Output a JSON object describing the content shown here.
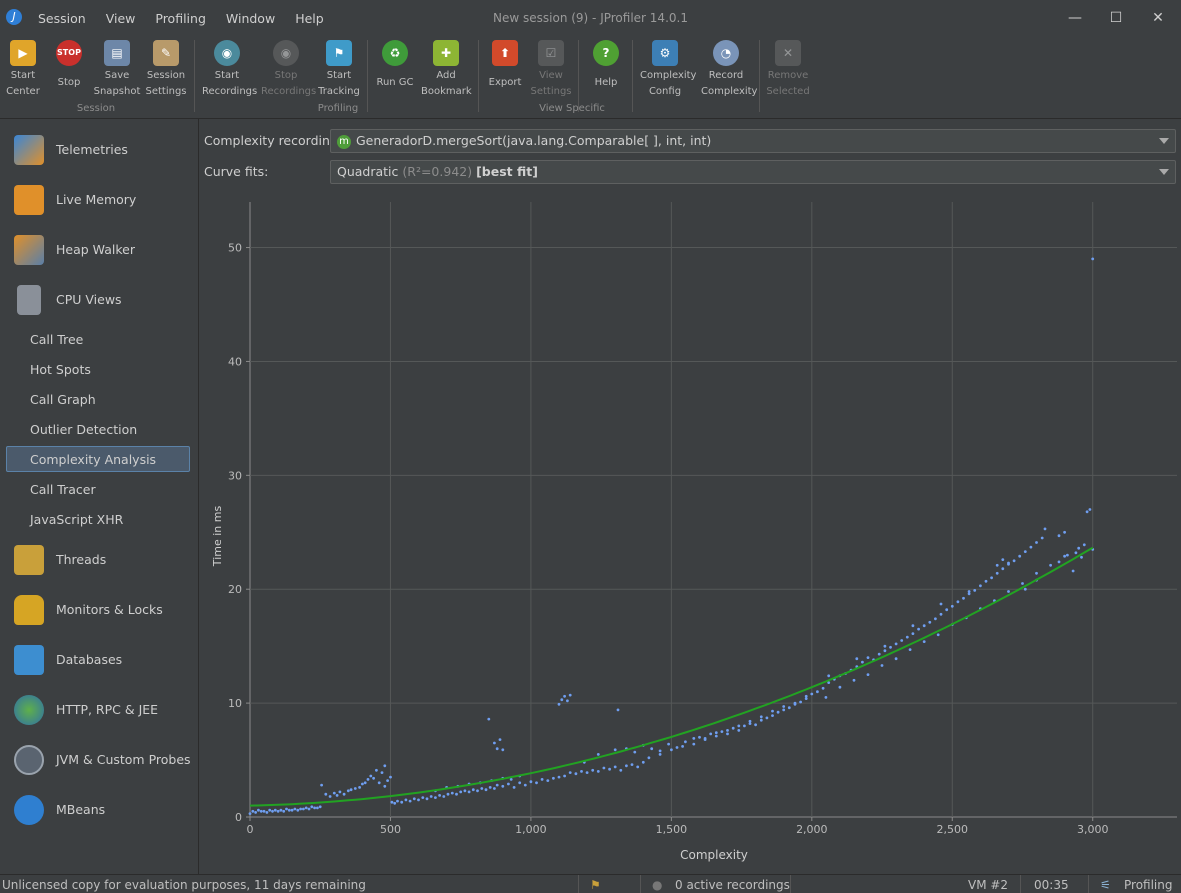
{
  "window": {
    "title": "New session (9) - JProfiler 14.0.1",
    "menu": [
      "Session",
      "View",
      "Profiling",
      "Window",
      "Help"
    ],
    "controls": {
      "minimize": "—",
      "maximize": "☐",
      "close": "✕"
    }
  },
  "toolbar": {
    "groups": [
      {
        "label": "Session",
        "buttons": [
          {
            "label1": "Start",
            "label2": "Center",
            "icon": "start-center-icon",
            "enabled": true
          },
          {
            "label1": "Stop",
            "label2": "",
            "icon": "stop-icon",
            "enabled": true
          },
          {
            "label1": "Save",
            "label2": "Snapshot",
            "icon": "save-snapshot-icon",
            "enabled": true
          },
          {
            "label1": "Session",
            "label2": "Settings",
            "icon": "session-settings-icon",
            "enabled": true
          }
        ]
      },
      {
        "label": "Profiling",
        "buttons": [
          {
            "label1": "Start",
            "label2": "Recordings",
            "icon": "start-recordings-icon",
            "enabled": true
          },
          {
            "label1": "Stop",
            "label2": "Recordings",
            "icon": "stop-recordings-icon",
            "enabled": false
          },
          {
            "label1": "Start",
            "label2": "Tracking",
            "icon": "start-tracking-icon",
            "enabled": true
          },
          {
            "label1": "Run GC",
            "label2": "",
            "icon": "run-gc-icon",
            "enabled": true
          },
          {
            "label1": "Add",
            "label2": "Bookmark",
            "icon": "add-bookmark-icon",
            "enabled": true
          }
        ]
      },
      {
        "label": "View Specific",
        "buttons": [
          {
            "label1": "Export",
            "label2": "",
            "icon": "export-icon",
            "enabled": true
          },
          {
            "label1": "View",
            "label2": "Settings",
            "icon": "view-settings-icon",
            "enabled": false
          },
          {
            "label1": "Help",
            "label2": "",
            "icon": "help-icon",
            "enabled": true
          },
          {
            "label1": "Complexity",
            "label2": "Config",
            "icon": "complexity-config-icon",
            "enabled": true
          },
          {
            "label1": "Record",
            "label2": "Complexity",
            "icon": "record-complexity-icon",
            "enabled": true
          },
          {
            "label1": "Remove",
            "label2": "Selected",
            "icon": "remove-selected-icon",
            "enabled": false
          }
        ]
      }
    ]
  },
  "sidebar": {
    "sections": [
      {
        "label": "Telemetries",
        "icon": "telemetries-icon"
      },
      {
        "label": "Live Memory",
        "icon": "live-memory-icon"
      },
      {
        "label": "Heap Walker",
        "icon": "heap-walker-icon"
      },
      {
        "label": "CPU Views",
        "icon": "cpu-views-icon"
      }
    ],
    "cpu_items": [
      "Call Tree",
      "Hot Spots",
      "Call Graph",
      "Outlier Detection",
      "Complexity Analysis",
      "Call Tracer",
      "JavaScript XHR"
    ],
    "selected_item": "Complexity Analysis",
    "lower_sections": [
      {
        "label": "Threads",
        "icon": "threads-icon"
      },
      {
        "label": "Monitors & Locks",
        "icon": "monitors-locks-icon"
      },
      {
        "label": "Databases",
        "icon": "databases-icon"
      },
      {
        "label": "HTTP, RPC & JEE",
        "icon": "http-rpc-jee-icon"
      },
      {
        "label": "JVM & Custom Probes",
        "icon": "jvm-probes-icon"
      },
      {
        "label": "MBeans",
        "icon": "mbeans-icon"
      }
    ]
  },
  "complexity": {
    "recording_label": "Complexity recording:",
    "recording_badge": "m",
    "recording_value": "GeneradorD.mergeSort(java.lang.Comparable[ ], int, int)",
    "curve_label": "Curve fits:",
    "curve_value": "Quadratic",
    "curve_r2": "(R²=0.942)",
    "curve_best": "[best fit]"
  },
  "chart_data": {
    "type": "scatter",
    "xlabel": "Complexity",
    "ylabel": "Time in ms",
    "xlim": [
      0,
      3300
    ],
    "ylim": [
      0,
      54
    ],
    "x_ticks": [
      0,
      500,
      1000,
      1500,
      2000,
      2500,
      3000
    ],
    "x_tick_labels": [
      "0",
      "500",
      "1,000",
      "1,500",
      "2,000",
      "2,500",
      "3,000"
    ],
    "y_ticks": [
      0,
      10,
      20,
      30,
      40,
      50
    ],
    "grid": true,
    "point_color": "#6f9ef0",
    "fit_color": "#22a322",
    "fit": {
      "model": "quadratic",
      "a": 2.35e-06,
      "b": 0.0005,
      "c": 1.0,
      "x_range": [
        0,
        3000
      ]
    },
    "points": [
      [
        0,
        0.3
      ],
      [
        10,
        0.5
      ],
      [
        20,
        0.4
      ],
      [
        30,
        0.6
      ],
      [
        40,
        0.5
      ],
      [
        50,
        0.5
      ],
      [
        60,
        0.4
      ],
      [
        70,
        0.6
      ],
      [
        80,
        0.5
      ],
      [
        90,
        0.6
      ],
      [
        100,
        0.5
      ],
      [
        110,
        0.6
      ],
      [
        120,
        0.5
      ],
      [
        130,
        0.7
      ],
      [
        140,
        0.6
      ],
      [
        150,
        0.6
      ],
      [
        160,
        0.7
      ],
      [
        170,
        0.6
      ],
      [
        180,
        0.7
      ],
      [
        190,
        0.7
      ],
      [
        200,
        0.8
      ],
      [
        210,
        0.7
      ],
      [
        220,
        0.9
      ],
      [
        230,
        0.8
      ],
      [
        240,
        0.8
      ],
      [
        250,
        0.9
      ],
      [
        255,
        2.8
      ],
      [
        270,
        2.0
      ],
      [
        285,
        1.8
      ],
      [
        300,
        2.1
      ],
      [
        310,
        1.9
      ],
      [
        320,
        2.2
      ],
      [
        335,
        2.0
      ],
      [
        350,
        2.3
      ],
      [
        360,
        2.4
      ],
      [
        375,
        2.5
      ],
      [
        390,
        2.6
      ],
      [
        400,
        2.9
      ],
      [
        410,
        3.0
      ],
      [
        420,
        3.3
      ],
      [
        430,
        3.6
      ],
      [
        440,
        3.4
      ],
      [
        450,
        4.1
      ],
      [
        460,
        3.0
      ],
      [
        470,
        3.9
      ],
      [
        480,
        2.7
      ],
      [
        490,
        3.2
      ],
      [
        500,
        3.5
      ],
      [
        480,
        4.5
      ],
      [
        505,
        1.3
      ],
      [
        515,
        1.2
      ],
      [
        525,
        1.4
      ],
      [
        540,
        1.3
      ],
      [
        555,
        1.5
      ],
      [
        570,
        1.4
      ],
      [
        585,
        1.6
      ],
      [
        600,
        1.5
      ],
      [
        615,
        1.7
      ],
      [
        630,
        1.6
      ],
      [
        645,
        1.8
      ],
      [
        660,
        1.7
      ],
      [
        675,
        1.9
      ],
      [
        690,
        1.8
      ],
      [
        705,
        2.0
      ],
      [
        720,
        2.1
      ],
      [
        735,
        2.0
      ],
      [
        750,
        2.2
      ],
      [
        765,
        2.3
      ],
      [
        780,
        2.2
      ],
      [
        795,
        2.4
      ],
      [
        810,
        2.3
      ],
      [
        825,
        2.5
      ],
      [
        840,
        2.4
      ],
      [
        855,
        2.6
      ],
      [
        870,
        2.5
      ],
      [
        660,
        2.3
      ],
      [
        700,
        2.6
      ],
      [
        740,
        2.7
      ],
      [
        780,
        2.9
      ],
      [
        820,
        3.0
      ],
      [
        860,
        3.2
      ],
      [
        900,
        3.4
      ],
      [
        930,
        3.3
      ],
      [
        960,
        3.6
      ],
      [
        880,
        2.8
      ],
      [
        900,
        2.7
      ],
      [
        920,
        2.9
      ],
      [
        940,
        2.6
      ],
      [
        960,
        3.0
      ],
      [
        980,
        2.8
      ],
      [
        1000,
        3.1
      ],
      [
        1020,
        3.0
      ],
      [
        1040,
        3.3
      ],
      [
        1060,
        3.2
      ],
      [
        1080,
        3.4
      ],
      [
        1100,
        3.5
      ],
      [
        850,
        8.6
      ],
      [
        870,
        6.5
      ],
      [
        880,
        6.0
      ],
      [
        890,
        6.8
      ],
      [
        900,
        5.9
      ],
      [
        1100,
        9.9
      ],
      [
        1110,
        10.3
      ],
      [
        1120,
        10.6
      ],
      [
        1130,
        10.2
      ],
      [
        1140,
        10.7
      ],
      [
        1120,
        3.6
      ],
      [
        1140,
        3.9
      ],
      [
        1160,
        3.8
      ],
      [
        1180,
        4.0
      ],
      [
        1200,
        3.9
      ],
      [
        1220,
        4.1
      ],
      [
        1240,
        4.0
      ],
      [
        1260,
        4.3
      ],
      [
        1280,
        4.2
      ],
      [
        1300,
        4.4
      ],
      [
        1320,
        4.1
      ],
      [
        1340,
        4.5
      ],
      [
        1360,
        4.6
      ],
      [
        1380,
        4.4
      ],
      [
        1400,
        4.8
      ],
      [
        1190,
        4.8
      ],
      [
        1240,
        5.5
      ],
      [
        1300,
        5.9
      ],
      [
        1310,
        9.4
      ],
      [
        1340,
        6.0
      ],
      [
        1370,
        5.7
      ],
      [
        1400,
        6.3
      ],
      [
        1430,
        6.0
      ],
      [
        1460,
        5.8
      ],
      [
        1490,
        6.4
      ],
      [
        1520,
        6.1
      ],
      [
        1550,
        6.6
      ],
      [
        1580,
        6.9
      ],
      [
        1600,
        7.0
      ],
      [
        1620,
        6.8
      ],
      [
        1640,
        7.3
      ],
      [
        1660,
        7.1
      ],
      [
        1680,
        7.5
      ],
      [
        1700,
        7.3
      ],
      [
        1720,
        7.8
      ],
      [
        1740,
        7.6
      ],
      [
        1760,
        8.0
      ],
      [
        1780,
        8.2
      ],
      [
        1800,
        8.1
      ],
      [
        1820,
        8.5
      ],
      [
        1840,
        8.7
      ],
      [
        1860,
        8.9
      ],
      [
        1880,
        9.2
      ],
      [
        1900,
        9.4
      ],
      [
        1920,
        9.6
      ],
      [
        1940,
        9.9
      ],
      [
        1960,
        10.1
      ],
      [
        1980,
        10.4
      ],
      [
        2000,
        10.8
      ],
      [
        1420,
        5.2
      ],
      [
        1460,
        5.5
      ],
      [
        1500,
        5.9
      ],
      [
        1540,
        6.2
      ],
      [
        1580,
        6.4
      ],
      [
        1620,
        6.9
      ],
      [
        1660,
        7.4
      ],
      [
        1700,
        7.6
      ],
      [
        1740,
        8.0
      ],
      [
        1780,
        8.4
      ],
      [
        1820,
        8.8
      ],
      [
        1860,
        9.3
      ],
      [
        1900,
        9.7
      ],
      [
        1940,
        10.0
      ],
      [
        1980,
        10.6
      ],
      [
        2020,
        11.0
      ],
      [
        2040,
        11.3
      ],
      [
        2060,
        11.8
      ],
      [
        2080,
        12.1
      ],
      [
        2100,
        12.4
      ],
      [
        2120,
        12.6
      ],
      [
        2140,
        12.9
      ],
      [
        2160,
        13.2
      ],
      [
        2180,
        13.6
      ],
      [
        2200,
        14.0
      ],
      [
        2220,
        13.8
      ],
      [
        2240,
        14.3
      ],
      [
        2260,
        14.6
      ],
      [
        2280,
        14.9
      ],
      [
        2300,
        15.2
      ],
      [
        2320,
        15.5
      ],
      [
        2340,
        15.8
      ],
      [
        2360,
        16.1
      ],
      [
        2380,
        16.5
      ],
      [
        2400,
        16.8
      ],
      [
        2420,
        17.1
      ],
      [
        2440,
        17.4
      ],
      [
        2460,
        17.8
      ],
      [
        2480,
        18.2
      ],
      [
        2500,
        18.5
      ],
      [
        2520,
        18.9
      ],
      [
        2540,
        19.2
      ],
      [
        2560,
        19.6
      ],
      [
        2580,
        19.9
      ],
      [
        2600,
        20.3
      ],
      [
        2620,
        20.7
      ],
      [
        2640,
        21.0
      ],
      [
        2660,
        21.4
      ],
      [
        2680,
        21.8
      ],
      [
        2700,
        22.2
      ],
      [
        2720,
        22.5
      ],
      [
        2740,
        22.9
      ],
      [
        2760,
        23.3
      ],
      [
        2780,
        23.7
      ],
      [
        2800,
        24.1
      ],
      [
        2820,
        24.5
      ],
      [
        2050,
        10.5
      ],
      [
        2100,
        11.4
      ],
      [
        2150,
        12.0
      ],
      [
        2200,
        12.5
      ],
      [
        2250,
        13.3
      ],
      [
        2300,
        13.9
      ],
      [
        2350,
        14.7
      ],
      [
        2400,
        15.4
      ],
      [
        2450,
        16.0
      ],
      [
        2500,
        16.9
      ],
      [
        2550,
        17.5
      ],
      [
        2600,
        18.3
      ],
      [
        2650,
        19.0
      ],
      [
        2700,
        19.8
      ],
      [
        2750,
        20.5
      ],
      [
        2800,
        21.4
      ],
      [
        2850,
        22.1
      ],
      [
        2900,
        22.9
      ],
      [
        2950,
        23.6
      ],
      [
        2060,
        12.4
      ],
      [
        2160,
        13.9
      ],
      [
        2260,
        15.0
      ],
      [
        2360,
        16.8
      ],
      [
        2460,
        18.7
      ],
      [
        2560,
        19.8
      ],
      [
        2660,
        22.1
      ],
      [
        2680,
        22.6
      ],
      [
        2700,
        22.3
      ],
      [
        2760,
        20.0
      ],
      [
        2800,
        20.8
      ],
      [
        2830,
        25.3
      ],
      [
        2880,
        24.7
      ],
      [
        2900,
        25.0
      ],
      [
        2930,
        21.6
      ],
      [
        2960,
        22.8
      ],
      [
        2980,
        26.8
      ],
      [
        2990,
        27.0
      ],
      [
        3000,
        23.5
      ],
      [
        2970,
        23.9
      ],
      [
        2940,
        23.2
      ],
      [
        2910,
        23.0
      ],
      [
        2880,
        22.4
      ],
      [
        3000,
        49.0
      ]
    ]
  },
  "status": {
    "license": "Unlicensed copy for evaluation purposes, 11 days remaining",
    "recordings": "0 active recordings",
    "vm": "VM #2",
    "time": "00:35",
    "mode": "Profiling"
  }
}
